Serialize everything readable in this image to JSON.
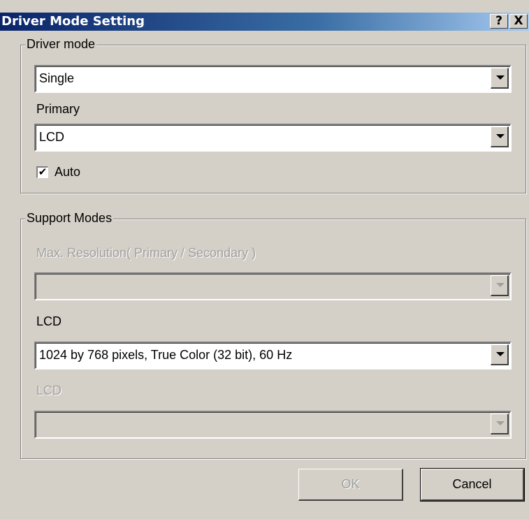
{
  "window": {
    "title": "Driver Mode Setting",
    "help_label": "?",
    "close_label": "X"
  },
  "driver_mode": {
    "group_label": "Driver mode",
    "mode_value": "Single",
    "primary_label": "Primary",
    "primary_value": "LCD",
    "auto_label": "Auto",
    "auto_checked": true
  },
  "support_modes": {
    "group_label": "Support Modes",
    "max_resolution_label": "Max. Resolution( Primary / Secondary )",
    "max_resolution_value": "",
    "lcd1_label": "LCD",
    "lcd1_value": "1024 by 768 pixels, True Color (32 bit), 60 Hz",
    "lcd2_label": "LCD",
    "lcd2_value": ""
  },
  "buttons": {
    "ok_label": "OK",
    "cancel_label": "Cancel"
  },
  "colors": {
    "titlebar_start": "#0a246a",
    "titlebar_end": "#a6caf0",
    "face": "#d4d0c8",
    "disabled_text": "#a0a0a0"
  }
}
